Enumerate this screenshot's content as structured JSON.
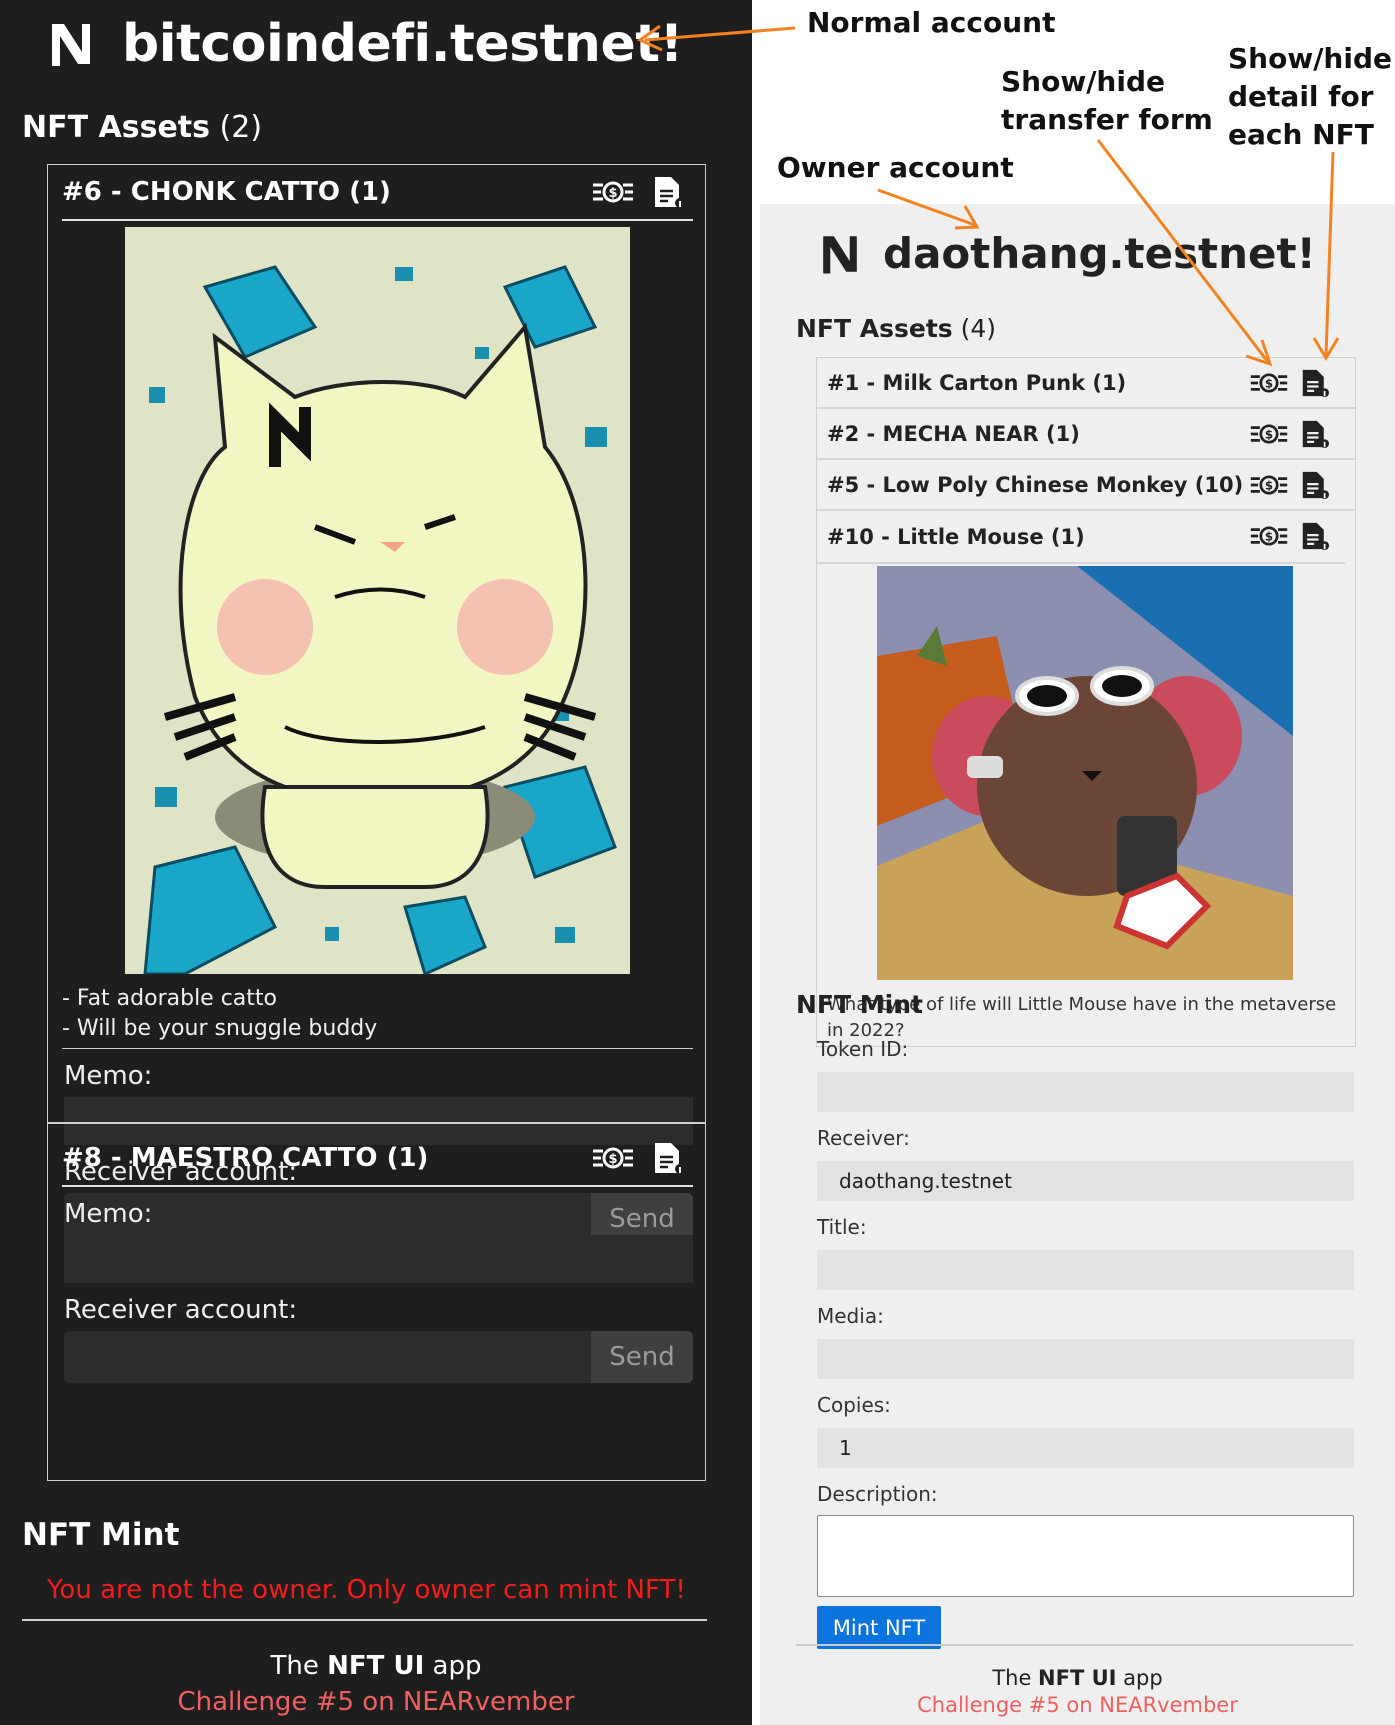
{
  "normal": {
    "title": "bitcoindefi.testnet!",
    "assets_label": "NFT Assets",
    "assets_count": "(2)",
    "items": [
      {
        "name": "#6 - CHONK CATTO (1)",
        "desc_line1": "- Fat adorable catto",
        "desc_line2": "- Will be your snuggle buddy",
        "memo_label": "Memo:",
        "receiver_label": "Receiver account:",
        "send_label": "Send"
      },
      {
        "name": "#8 - MAESTRO CATTO (1)",
        "memo_label": "Memo:",
        "receiver_label": "Receiver account:",
        "send_label": "Send"
      }
    ],
    "mint_title": "NFT Mint",
    "not_owner_msg": "You are not the owner. Only owner can mint NFT!",
    "footer_pre": "The ",
    "footer_bold": "NFT UI",
    "footer_post": " app",
    "footer_link": "Challenge #5 on NEARvember"
  },
  "owner": {
    "title": "daothang.testnet!",
    "assets_label": "NFT Assets",
    "assets_count": "(4)",
    "items": [
      "#1 - Milk Carton Punk (1)",
      "#2 - MECHA NEAR (1)",
      "#5 - Low Poly Chinese Monkey (10)",
      "#10 - Little Mouse (1)"
    ],
    "detail_desc": "What type of life will Little Mouse have in the metaverse in 2022?",
    "mint": {
      "title": "NFT Mint",
      "token_id_label": "Token ID:",
      "token_id_value": "",
      "receiver_label": "Receiver:",
      "receiver_value": "daothang.testnet",
      "title_label": "Title:",
      "title_value": "",
      "media_label": "Media:",
      "media_value": "",
      "copies_label": "Copies:",
      "copies_value": "1",
      "description_label": "Description:",
      "button_label": "Mint NFT"
    },
    "footer_pre": "The ",
    "footer_bold": "NFT UI",
    "footer_post": " app",
    "footer_link": "Challenge #5 on NEARvember"
  },
  "annotations": {
    "normal_account": "Normal account",
    "owner_account": "Owner account",
    "transfer_line1": "Show/hide",
    "transfer_line2": "transfer form",
    "detail_line1": "Show/hide",
    "detail_line2": "detail for",
    "detail_line3": "each NFT"
  },
  "colors": {
    "dark_bg": "#1e1e1e",
    "light_bg": "#efefef",
    "annotation_arrow": "#f58220",
    "error_red": "#f41c1c",
    "link_red": "#f06060",
    "mint_button": "#0b74de"
  },
  "icons": {
    "near_logo": "near-logo-icon",
    "transfer": "money-transfer-icon",
    "detail": "document-info-icon"
  }
}
